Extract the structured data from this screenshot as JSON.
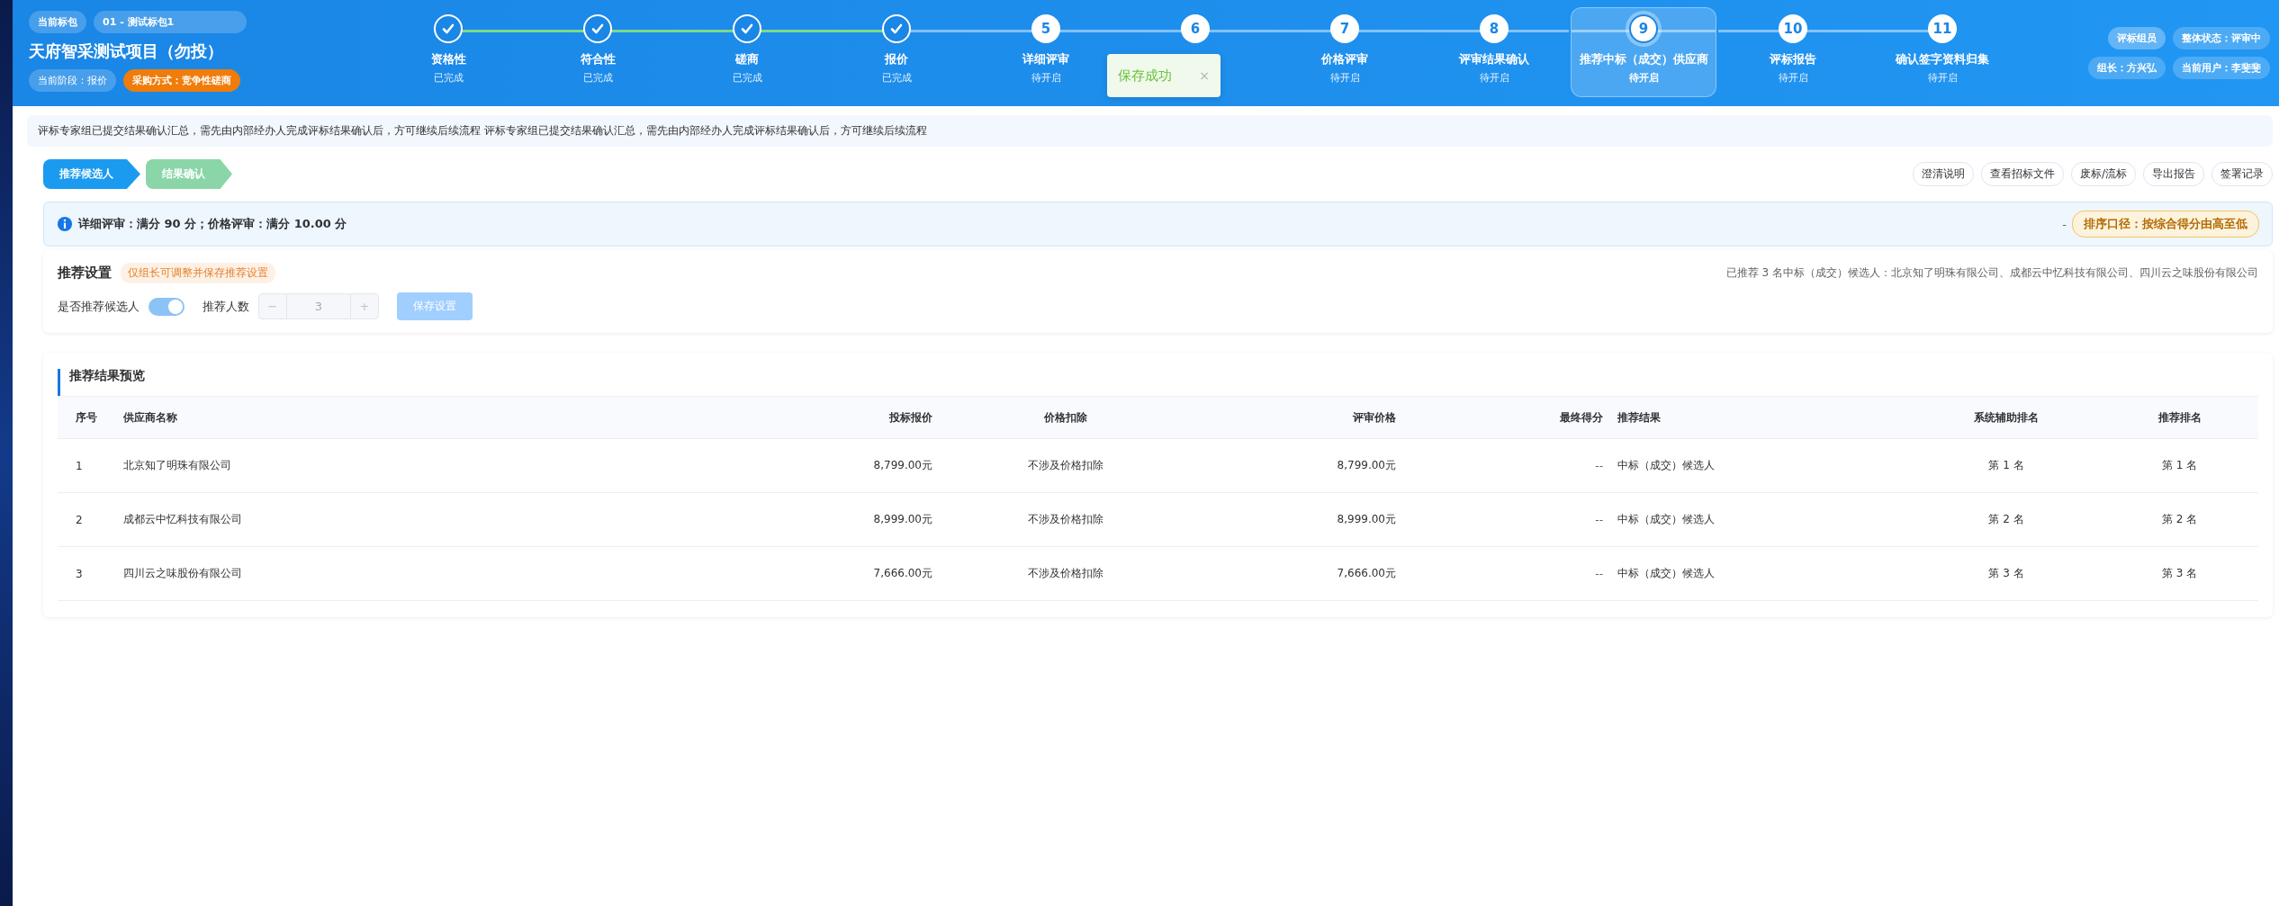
{
  "header": {
    "package_label": "当前标包",
    "package_value": "01 - 测试标包1",
    "title": "天府智采测试项目（勿投）",
    "stage": "当前阶段：报价",
    "method": "采购方式：竞争性磋商",
    "steps": [
      {
        "label": "资格性",
        "status": "已完成",
        "done": true,
        "selected": false
      },
      {
        "label": "符合性",
        "status": "已完成",
        "done": true,
        "selected": false
      },
      {
        "label": "磋商",
        "status": "已完成",
        "done": true,
        "selected": false
      },
      {
        "label": "报价",
        "status": "已完成",
        "done": true,
        "selected": false
      },
      {
        "number": "5",
        "label": "详细评审",
        "status": "待开启",
        "done": false,
        "selected": false
      },
      {
        "number": "6",
        "done": false,
        "selected": false
      },
      {
        "number": "7",
        "label": "价格评审",
        "status": "待开启",
        "done": false,
        "selected": false
      },
      {
        "number": "8",
        "label": "评审结果确认",
        "status": "待开启",
        "done": false,
        "selected": false
      },
      {
        "number": "9",
        "label": "推荐中标（成交）供应商",
        "status": "待开启",
        "done": false,
        "selected": true
      },
      {
        "number": "10",
        "label": "评标报告",
        "status": "待开启",
        "done": false,
        "selected": false
      },
      {
        "number": "11",
        "label": "确认签字资料归集",
        "status": "待开启",
        "done": false,
        "selected": false
      }
    ],
    "role": "评标组员",
    "overall": "整体状态：评审中",
    "leader": "组长：方兴弘",
    "user": "当前用户：李斐斐"
  },
  "toast": {
    "text": "保存成功",
    "close": "×"
  },
  "notice": "评标专家组已提交结果确认汇总，需先由内部经办人完成评标结果确认后，方可继续后续流程 评标专家组已提交结果确认汇总，需先由内部经办人完成评标结果确认后，方可继续后续流程",
  "substeps": [
    {
      "label": "推荐候选人",
      "selected": true
    },
    {
      "label": "结果确认",
      "selected": false
    }
  ],
  "actions": [
    "澄清说明",
    "查看招标文件",
    "废标/流标",
    "导出报告",
    "签署记录"
  ],
  "info": {
    "text": "详细评审：满分 90 分；价格评审：满分 10.00 分",
    "dash": "-",
    "sort": "排序口径：按综合得分由高至低"
  },
  "settings": {
    "title": "推荐设置",
    "tag": "仅组长可调整并保存推荐设置",
    "summary": "已推荐 3 名中标（成交）候选人：北京知了明珠有限公司、成都云中忆科技有限公司、四川云之味股份有限公司",
    "toggle_label": "是否推荐候选人",
    "toggle_on": true,
    "count_label": "推荐人数",
    "count_minus": "−",
    "count_value": "3",
    "count_plus": "+",
    "save": "保存设置",
    "save_disabled": true
  },
  "results": {
    "title": "推荐结果预览",
    "columns": [
      "序号",
      "供应商名称",
      "投标报价",
      "价格扣除",
      "评审价格",
      "最终得分",
      "推荐结果",
      "系统辅助排名",
      "推荐排名"
    ],
    "rows": [
      [
        "1",
        "北京知了明珠有限公司",
        "8,799.00元",
        "不涉及价格扣除",
        "8,799.00元",
        "--",
        "中标（成交）候选人",
        "第 1 名",
        "第 1 名"
      ],
      [
        "2",
        "成都云中忆科技有限公司",
        "8,999.00元",
        "不涉及价格扣除",
        "8,999.00元",
        "--",
        "中标（成交）候选人",
        "第 2 名",
        "第 2 名"
      ],
      [
        "3",
        "四川云之味股份有限公司",
        "7,666.00元",
        "不涉及价格扣除",
        "7,666.00元",
        "--",
        "中标（成交）候选人",
        "第 3 名",
        "第 3 名"
      ]
    ]
  }
}
